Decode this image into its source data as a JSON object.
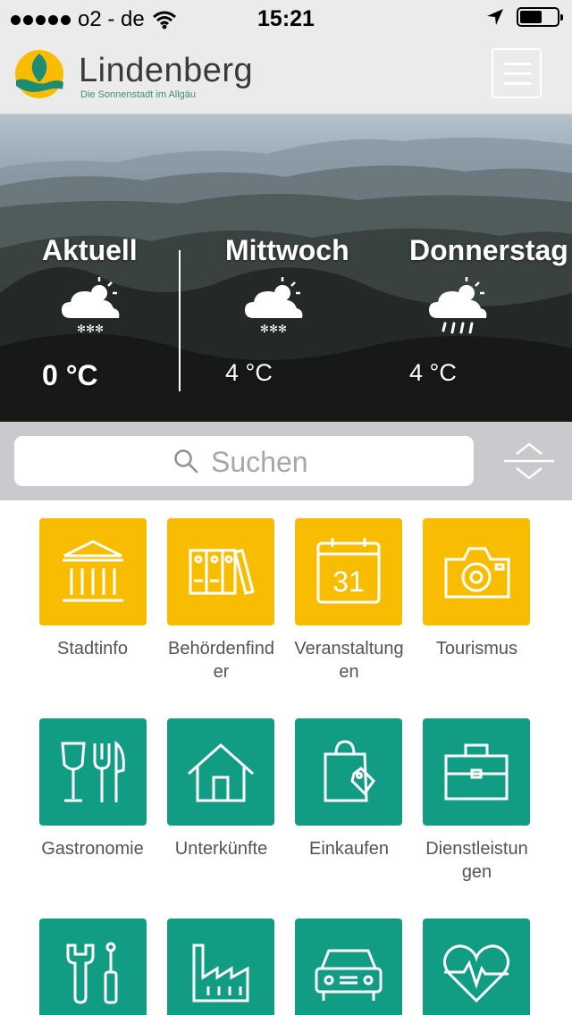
{
  "status_bar": {
    "carrier": "o2 - de",
    "time": "15:21",
    "battery_level": 0.6
  },
  "header": {
    "title": "Lindenberg",
    "subtitle": "Die Sonnenstadt im Allgäu"
  },
  "weather": [
    {
      "day": "Aktuell",
      "temp": "0 °C",
      "icon": "snow-cloud-icon"
    },
    {
      "day": "Mittwoch",
      "temp": "4 °C",
      "icon": "snow-cloud-icon"
    },
    {
      "day": "Donnerstag",
      "temp": "4 °C",
      "icon": "rain-cloud-icon"
    }
  ],
  "search": {
    "placeholder": "Suchen"
  },
  "tiles": [
    {
      "label": "Stadtinfo",
      "icon": "building-icon",
      "color": "#f8bd00"
    },
    {
      "label": "Behördenfind\ner",
      "icon": "folders-icon",
      "color": "#f8bd00"
    },
    {
      "label": "Veranstaltung\nen",
      "icon": "calendar-icon",
      "calendar_day": "31",
      "color": "#f8bd00"
    },
    {
      "label": "Tourismus",
      "icon": "camera-icon",
      "color": "#f8bd00"
    },
    {
      "label": "Gastronomie",
      "icon": "wine-cutlery-icon",
      "color": "#119c84"
    },
    {
      "label": "Unterkünfte",
      "icon": "house-icon",
      "color": "#119c84"
    },
    {
      "label": "Einkaufen",
      "icon": "shopping-bag-icon",
      "color": "#119c84"
    },
    {
      "label": "Dienstleistun\ngen",
      "icon": "briefcase-icon",
      "color": "#119c84"
    },
    {
      "label": "",
      "icon": "tools-icon",
      "color": "#119c84"
    },
    {
      "label": "",
      "icon": "factory-icon",
      "color": "#119c84"
    },
    {
      "label": "",
      "icon": "car-icon",
      "color": "#119c84"
    },
    {
      "label": "",
      "icon": "heart-pulse-icon",
      "color": "#119c84"
    }
  ]
}
